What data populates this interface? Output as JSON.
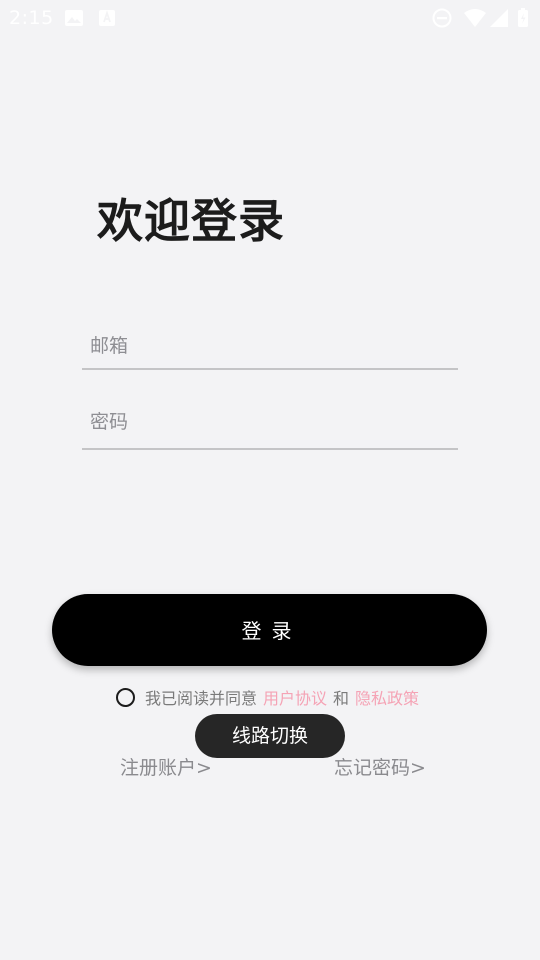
{
  "status_bar": {
    "time": "2:15",
    "icons": [
      "image-icon",
      "a-notification-icon",
      "do-not-disturb-icon",
      "wifi-icon",
      "signal-icon",
      "battery-icon"
    ]
  },
  "title": "欢迎登录",
  "email_field": {
    "placeholder": "邮箱",
    "value": ""
  },
  "password_field": {
    "placeholder": "密码",
    "value": ""
  },
  "login_button": "登录",
  "agreement": {
    "prefix": "我已阅读并同意",
    "user_agreement": "用户协议",
    "and": "和",
    "privacy_policy": "隐私政策",
    "checked": false
  },
  "toast": "线路切换",
  "register_link": "注册账户>",
  "forgot_link": "忘记密码>",
  "colors": {
    "background": "#f3f3f5",
    "button": "#000000",
    "link": "#f5a3b5",
    "toast": "#262626"
  }
}
